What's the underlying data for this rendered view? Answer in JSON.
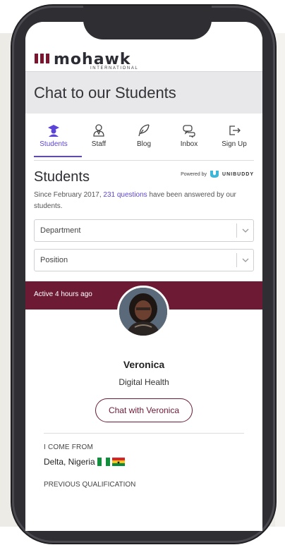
{
  "brand": {
    "name": "mohawk",
    "sub": "INTERNATIONAL"
  },
  "page_title": "Chat to our Students",
  "tabs": [
    {
      "label": "Students",
      "icon": "student-icon",
      "active": true
    },
    {
      "label": "Staff",
      "icon": "staff-icon"
    },
    {
      "label": "Blog",
      "icon": "feather-icon"
    },
    {
      "label": "Inbox",
      "icon": "chat-bubbles-icon"
    },
    {
      "label": "Sign Up",
      "icon": "sign-up-icon"
    }
  ],
  "students": {
    "heading": "Students",
    "powered_by": "Powered by",
    "powered_brand": "UNIBUDDY",
    "since_prefix": "Since February 2017, ",
    "since_link": "231 questions",
    "since_suffix": " have been answered by our students."
  },
  "filters": {
    "department": "Department",
    "position": "Position"
  },
  "card": {
    "status": "Active 4 hours ago",
    "name": "Veronica",
    "subject": "Digital Health",
    "chat_button": "Chat with Veronica",
    "come_from_label": "I COME FROM",
    "come_from_value": "Delta, Nigeria",
    "prev_qual_label": "PREVIOUS QUALIFICATION"
  },
  "colors": {
    "accent": "#5b45d9",
    "brand": "#6d1a35"
  }
}
